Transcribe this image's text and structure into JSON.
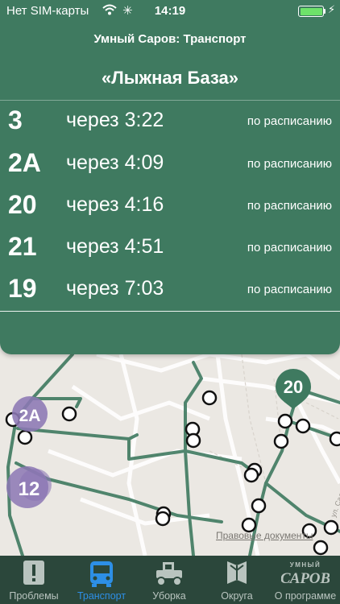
{
  "status_bar": {
    "carrier": "Нет SIM-карты",
    "time": "14:19",
    "icons": [
      "wifi-icon",
      "activity-spinner-icon",
      "battery-icon",
      "charging-bolt-icon"
    ]
  },
  "header": {
    "app_title": "Умный Саров: Транспорт",
    "stop_name": "«Лыжная База»"
  },
  "arrivals": [
    {
      "route": "3",
      "eta": "через 3:22",
      "mode": "по расписанию"
    },
    {
      "route": "2А",
      "eta": "через 4:09",
      "mode": "по расписанию"
    },
    {
      "route": "20",
      "eta": "через 4:16",
      "mode": "по расписанию"
    },
    {
      "route": "21",
      "eta": "через 4:51",
      "mode": "по расписанию"
    },
    {
      "route": "19",
      "eta": "через 7:03",
      "mode": "по расписанию"
    }
  ],
  "map": {
    "bus_markers": [
      {
        "label": "2А",
        "color": "#8c77b4"
      },
      {
        "label": "12",
        "color": "#8c77b4"
      },
      {
        "label": "20",
        "color": "#3f7a60"
      }
    ],
    "legal_link": "Правовые документы"
  },
  "tabs": [
    {
      "label": "Проблемы",
      "icon": "alert-icon",
      "active": false
    },
    {
      "label": "Транспорт",
      "icon": "bus-icon",
      "active": true
    },
    {
      "label": "Уборка",
      "icon": "tractor-icon",
      "active": false
    },
    {
      "label": "Округа",
      "icon": "map-fold-icon",
      "active": false
    },
    {
      "label": "О программе",
      "icon": "app-logo-icon",
      "logo_text": [
        "УМНЫЙ",
        "САРОВ"
      ],
      "active": false
    }
  ],
  "colors": {
    "panel": "#3f7a60",
    "tabbar": "#2b473b",
    "active_tab": "#2d8fe6",
    "inactive_tab": "#b9c4bf",
    "route_line": "#3f7a60",
    "map_bg": "#ebe8e3"
  }
}
